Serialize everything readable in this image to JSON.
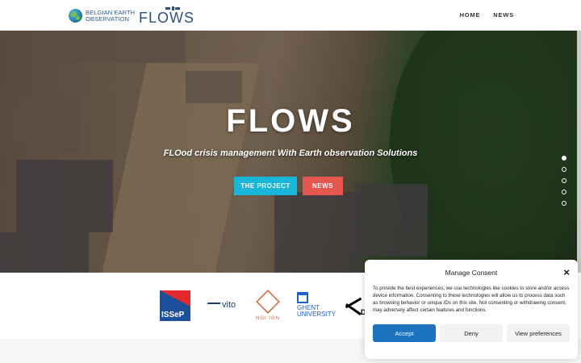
{
  "header": {
    "brand_line1": "BELGIAN EARTH",
    "brand_line2": "OBSERVATION",
    "flows_logo": "FLOWS",
    "nav": [
      "HOME",
      "NEWS"
    ]
  },
  "hero": {
    "title": "FLOWS",
    "subtitle": "FLOod crisis management With Earth observation Solutions",
    "primary_button": "THE PROJECT",
    "secondary_button": "NEWS",
    "slides_total": 5,
    "active_slide": 1,
    "colors": {
      "primary": "#18b6d8",
      "secondary": "#e5574f"
    }
  },
  "partners": {
    "issep": "ISSeP",
    "vito": "vito",
    "ngi": "NGI  IGN",
    "ghent_line1": "GHENT",
    "ghent_line2": "UNIVERSITY",
    "dlr": "D"
  },
  "consent": {
    "title": "Manage Consent",
    "body": "To provide the best experiences, we use technologies like cookies to store and/or access device information. Consenting to these technologies will allow us to process data such as browsing behavior or unique IDs on this site. Not consenting or withdrawing consent, may adversely affect certain features and functions.",
    "accept": "Accept",
    "deny": "Deny",
    "preferences": "View preferences",
    "close_icon": "×"
  }
}
